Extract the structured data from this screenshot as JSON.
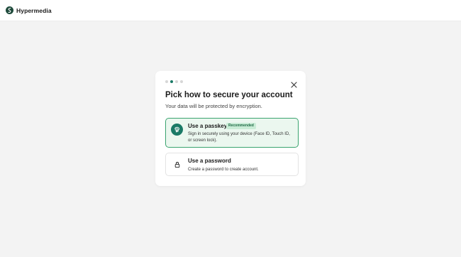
{
  "header": {
    "brand_name": "Hypermedia",
    "logo_icon": "leaf-s-logo-icon",
    "logo_color": "#1e4a3b"
  },
  "dialog": {
    "steps": {
      "total": 4,
      "current": 2
    },
    "close_icon": "close-icon",
    "title": "Pick how to secure your account",
    "subtitle": "Your data will be protected by encryption.",
    "options": [
      {
        "title": "Use a passkey",
        "badge": "Recommended",
        "description": "Sign in securely using your device (Face ID, Touch ID, or screen lock).",
        "icon": "fingerprint-icon",
        "selected": true
      },
      {
        "title": "Use a password",
        "description": "Create a password to create account.",
        "icon": "lock-icon",
        "selected": false
      }
    ]
  },
  "colors": {
    "accent": "#1a7a66",
    "selected_bg": "#ebf7ef",
    "selected_border": "#3aa36f",
    "badge_bg": "#c9ecd6"
  }
}
